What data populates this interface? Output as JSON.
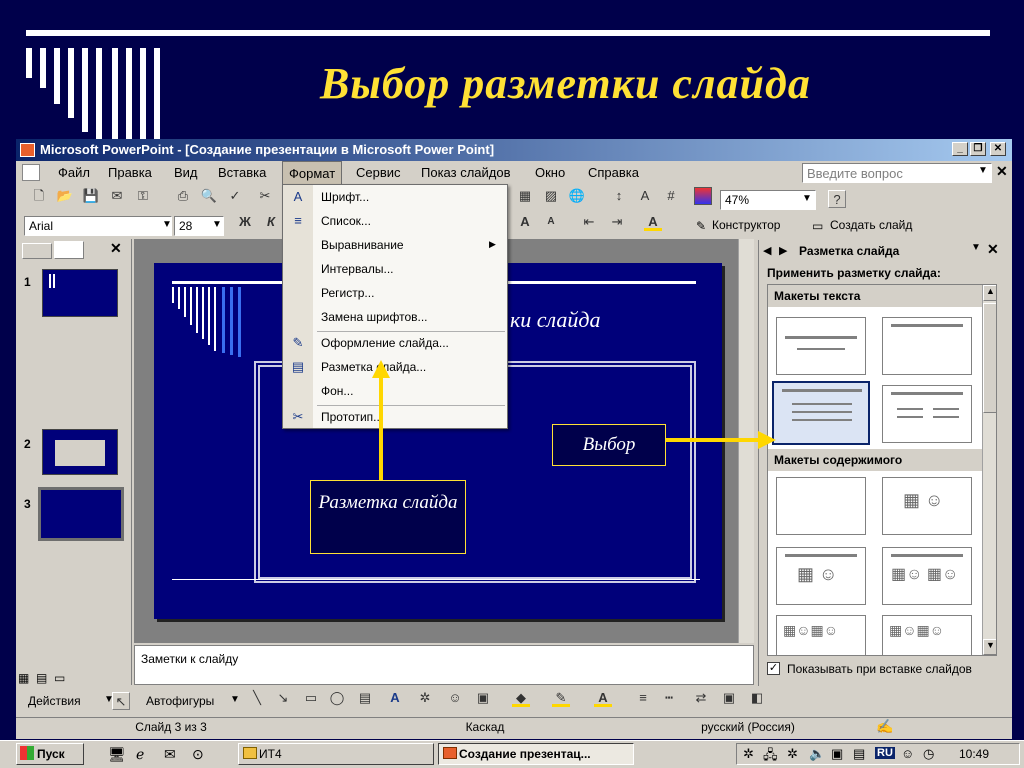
{
  "heading": "Выбор разметки слайда",
  "window": {
    "title": "Microsoft PowerPoint - [Создание презентации в Microsoft Power Point]",
    "help_placeholder": "Введите вопрос"
  },
  "menu": [
    "Файл",
    "Правка",
    "Вид",
    "Вставка",
    "Формат",
    "Сервис",
    "Показ слайдов",
    "Окно",
    "Справка"
  ],
  "toolbar": {
    "zoom": "47%",
    "font": "Arial",
    "size": "28",
    "designer": "Конструктор",
    "new_slide": "Создать слайд"
  },
  "format_menu": [
    {
      "label": "Шрифт...",
      "icon": "A"
    },
    {
      "label": "Список...",
      "icon": "≡"
    },
    {
      "label": "Выравнивание",
      "icon": "",
      "submenu": true
    },
    {
      "label": "Интервалы...",
      "icon": ""
    },
    {
      "label": "Регистр...",
      "icon": ""
    },
    {
      "label": "Замена шрифтов...",
      "icon": ""
    },
    {
      "label": "Оформление слайда...",
      "icon": "✎"
    },
    {
      "label": "Разметка слайда...",
      "icon": "▤"
    },
    {
      "label": "Фон...",
      "icon": ""
    },
    {
      "label": "Прототип...",
      "icon": "✂"
    }
  ],
  "slides_panel": {
    "numbers": [
      "1",
      "2",
      "3"
    ]
  },
  "slide": {
    "title_fragment": "ки слайда"
  },
  "callouts": {
    "layout": "Разметка слайда",
    "choice": "Выбор"
  },
  "task_pane": {
    "title": "Разметка слайда",
    "apply": "Применить разметку слайда:",
    "text_layouts": "Макеты текста",
    "content_layouts": "Макеты содержимого",
    "show_on_insert": "Показывать при вставке слайдов"
  },
  "notes": "Заметки к слайду",
  "drawing": {
    "actions": "Действия",
    "autoshapes": "Автофигуры"
  },
  "status": {
    "slide": "Слайд 3 из 3",
    "design": "Каскад",
    "lang": "русский (Россия)"
  },
  "taskbar": {
    "start": "Пуск",
    "folder": "ИТ4",
    "app": "Создание презентац...",
    "lang": "RU",
    "time": "10:49"
  }
}
